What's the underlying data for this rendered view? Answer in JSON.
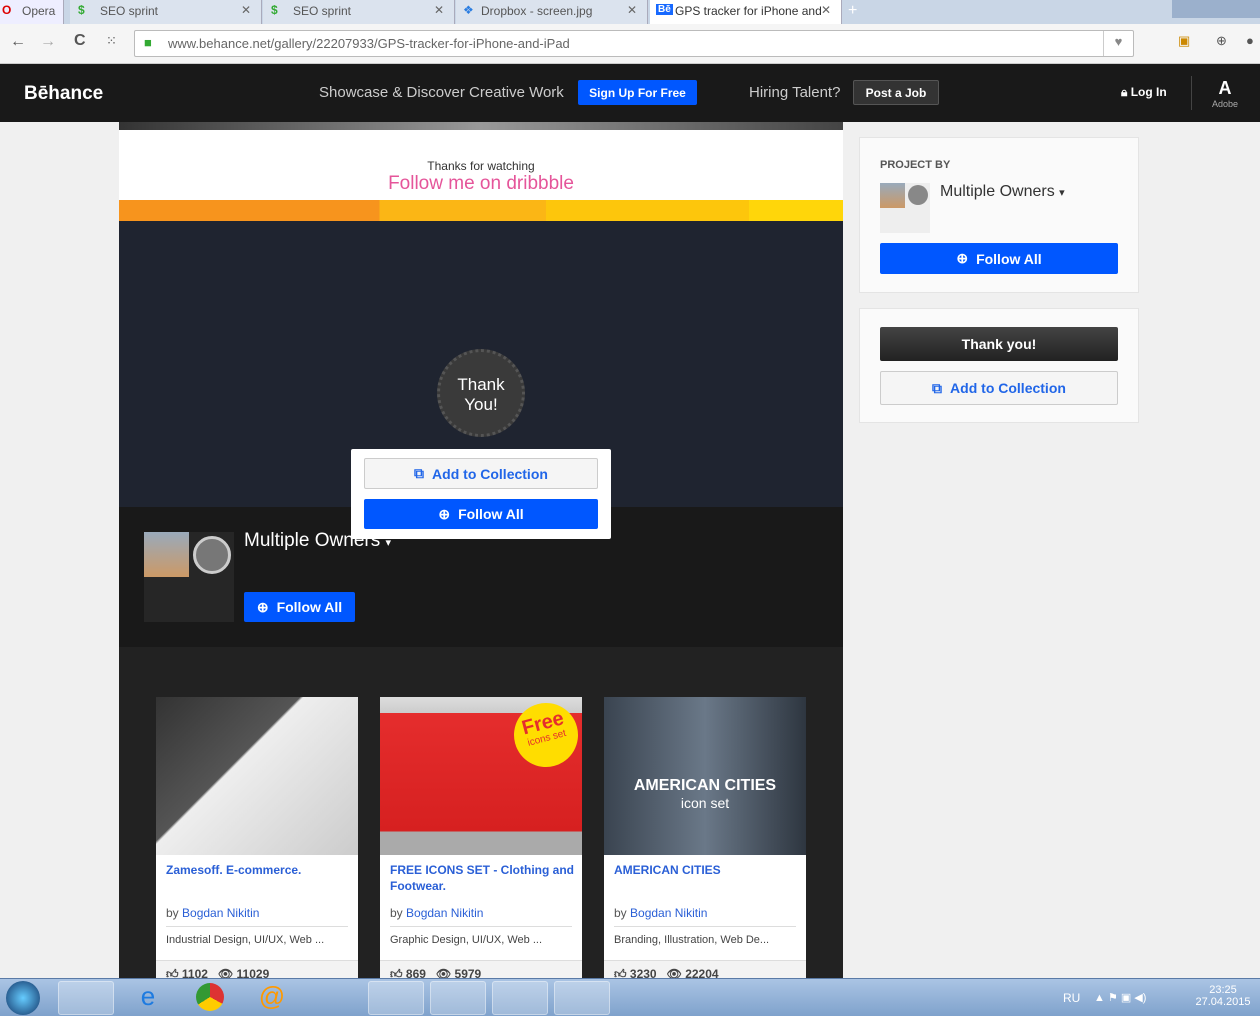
{
  "browser": {
    "tabs": [
      {
        "label": "Opera"
      },
      {
        "label": "SEO sprint"
      },
      {
        "label": "SEO sprint"
      },
      {
        "label": "Dropbox - screen.jpg"
      },
      {
        "label": "GPS tracker for iPhone and"
      }
    ],
    "url": "www.behance.net/gallery/22207933/GPS-tracker-for-iPhone-and-iPad"
  },
  "header": {
    "logo": "Bēhance",
    "tagline": "Showcase & Discover Creative Work",
    "signup": "Sign Up For Free",
    "hiring": "Hiring Talent?",
    "post_job": "Post a Job",
    "login": "Log In",
    "adobe": "Adobe"
  },
  "project": {
    "thanks": "Thanks for watching",
    "follow_dribbble": "Follow me on dribbble",
    "badge_line1": "Thank",
    "badge_line2": "You!",
    "popup_add": "Add to Collection",
    "popup_follow": "Follow All",
    "owners": "Multiple Owners",
    "follow_all": "Follow All"
  },
  "sidebar": {
    "project_by": "PROJECT BY",
    "owners": "Multiple Owners",
    "follow_all": "Follow All",
    "thank_you": "Thank you!",
    "add_collection": "Add to Collection"
  },
  "cards": [
    {
      "title": "Zamesoff. E-commerce.",
      "by": "by",
      "author": "Bogdan Nikitin",
      "tags": "Industrial Design, UI/UX, Web ...",
      "likes": "1102",
      "views": "11029"
    },
    {
      "title": "FREE ICONS SET - Clothing and Footwear.",
      "by": "by",
      "author": "Bogdan Nikitin",
      "tags": "Graphic Design, UI/UX, Web ...",
      "likes": "869",
      "views": "5979",
      "badge1": "Free",
      "badge2": "icons set"
    },
    {
      "title": "AMERICAN CITIES",
      "by": "by",
      "author": "Bogdan Nikitin",
      "tags": "Branding, Illustration, Web De...",
      "likes": "3230",
      "views": "22204",
      "img_title": "AMERICAN CITIES",
      "img_sub": "icon set"
    }
  ],
  "taskbar": {
    "lang": "RU",
    "time": "23:25",
    "date": "27.04.2015"
  }
}
